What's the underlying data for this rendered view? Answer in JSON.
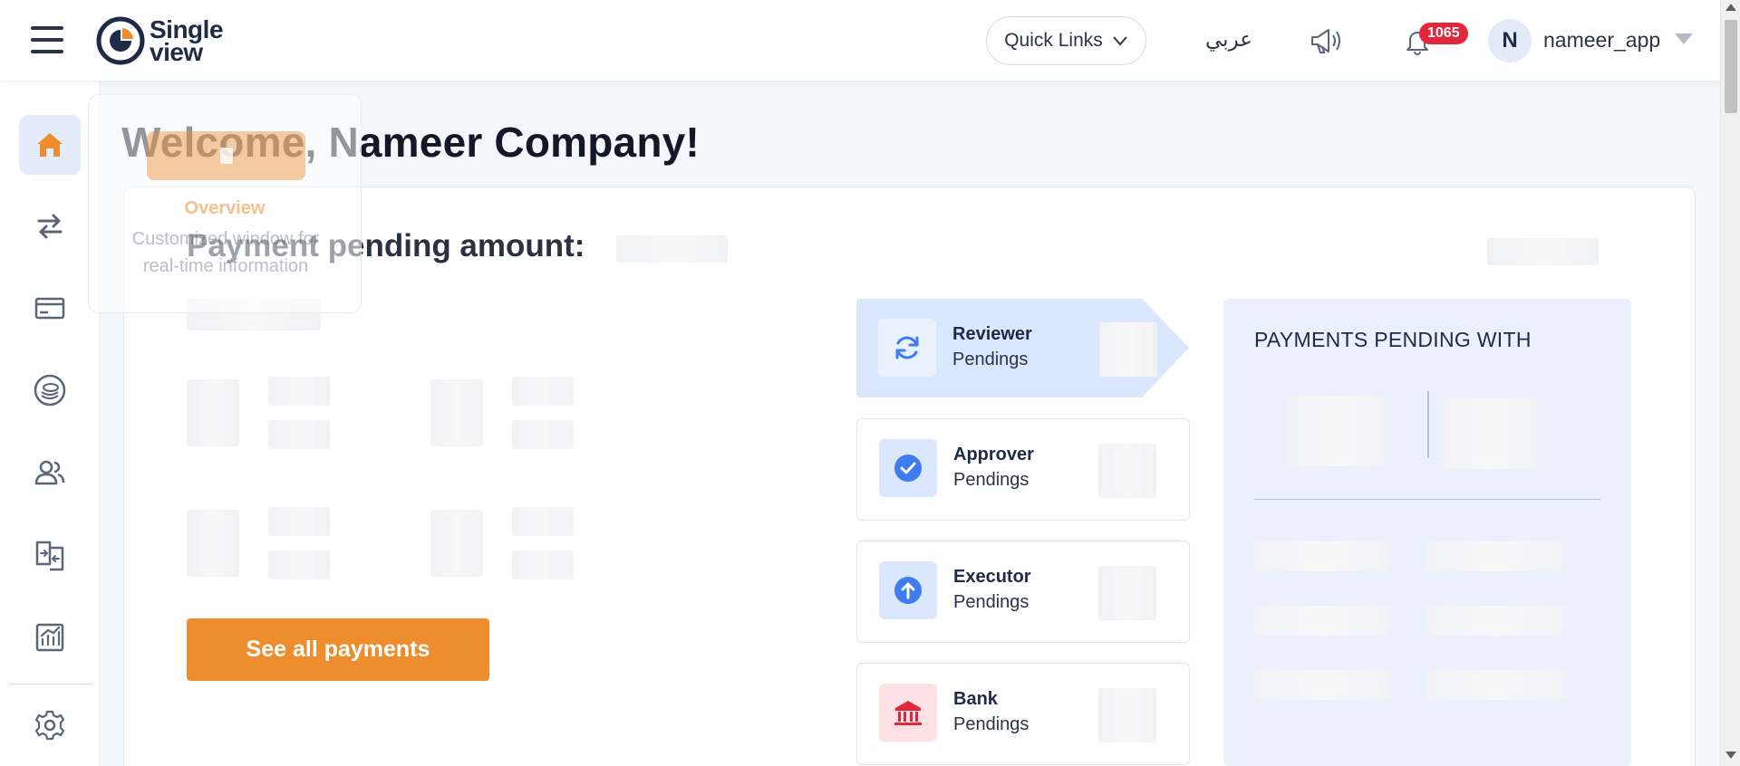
{
  "header": {
    "menu_icon": "hamburger-menu-icon",
    "logo_line1": "Single",
    "logo_line2": "view",
    "quick_links_label": "Quick Links",
    "language_label": "عربي",
    "notification_count": "1065",
    "avatar_initial": "N",
    "username": "nameer_app"
  },
  "sidebar": {
    "items": [
      {
        "icon": "home-icon",
        "active": true
      },
      {
        "icon": "transfer-arrows-icon",
        "active": false
      },
      {
        "icon": "card-icon",
        "active": false
      },
      {
        "icon": "coins-icon",
        "active": false
      },
      {
        "icon": "users-icon",
        "active": false
      },
      {
        "icon": "document-exchange-icon",
        "active": false
      },
      {
        "icon": "analytics-chart-icon",
        "active": false
      },
      {
        "icon": "gear-icon",
        "active": false
      }
    ]
  },
  "main": {
    "welcome_prefix": "Welcome, ",
    "company_name": "Nameer Company!",
    "payment_pending_label": "Payment pending amount:",
    "see_all_button": "See all payments",
    "statuses": [
      {
        "title": "Reviewer",
        "subtitle": "Pendings",
        "icon": "refresh-cycle-icon",
        "active": true
      },
      {
        "title": "Approver",
        "subtitle": "Pendings",
        "icon": "check-circle-icon",
        "active": false
      },
      {
        "title": "Executor",
        "subtitle": "Pendings",
        "icon": "arrow-up-circle-icon",
        "active": false
      },
      {
        "title": "Bank",
        "subtitle": "Pendings",
        "icon": "bank-icon",
        "active": false
      }
    ],
    "payments_pending_with_title": "PAYMENTS PENDING WITH"
  },
  "tour_tip": {
    "title": "Overview",
    "description": "Customized window for real-time information"
  },
  "colors": {
    "accent_orange": "#ee8d2e",
    "active_blue_bg": "#dae7fd",
    "primary_blue": "#3f7cf0",
    "notification_red": "#e2273b"
  }
}
